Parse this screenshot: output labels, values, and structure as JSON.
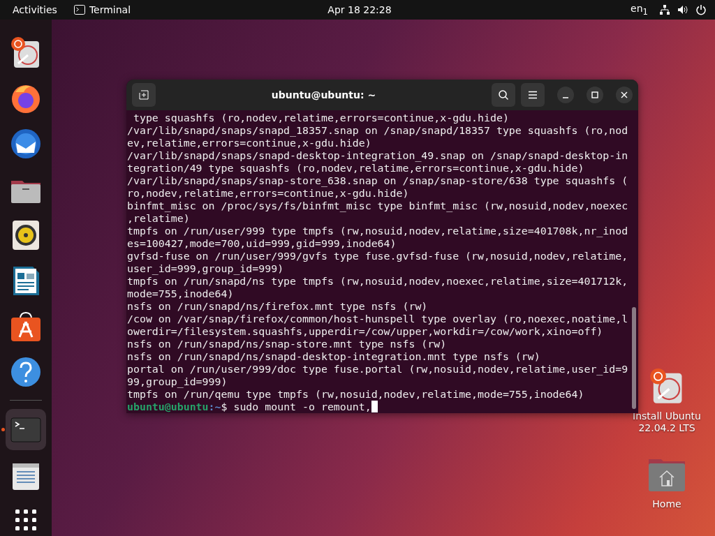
{
  "top_bar": {
    "activities": "Activities",
    "app_name": "Terminal",
    "clock": "Apr 18  22:28",
    "keyboard_layout": "en$_{1}$"
  },
  "dock": {
    "items": [
      {
        "kind": "installer",
        "running": false
      },
      {
        "kind": "browser",
        "running": false
      },
      {
        "kind": "mail",
        "running": false
      },
      {
        "kind": "files",
        "running": false
      },
      {
        "kind": "music",
        "running": false
      },
      {
        "kind": "writer",
        "running": false
      },
      {
        "kind": "store",
        "running": false
      },
      {
        "kind": "help",
        "running": false
      },
      {
        "kind": "terminal",
        "running": true
      },
      {
        "kind": "editor",
        "running": false
      }
    ]
  },
  "terminal": {
    "title": "ubuntu@ubuntu: ~",
    "lines": [
      " type squashfs (ro,nodev,relatime,errors=continue,x-gdu.hide)",
      "/var/lib/snapd/snaps/snapd_18357.snap on /snap/snapd/18357 type squashfs (ro,nod",
      "ev,relatime,errors=continue,x-gdu.hide)",
      "/var/lib/snapd/snaps/snapd-desktop-integration_49.snap on /snap/snapd-desktop-in",
      "tegration/49 type squashfs (ro,nodev,relatime,errors=continue,x-gdu.hide)",
      "/var/lib/snapd/snaps/snap-store_638.snap on /snap/snap-store/638 type squashfs (",
      "ro,nodev,relatime,errors=continue,x-gdu.hide)",
      "binfmt_misc on /proc/sys/fs/binfmt_misc type binfmt_misc (rw,nosuid,nodev,noexec",
      ",relatime)",
      "tmpfs on /run/user/999 type tmpfs (rw,nosuid,nodev,relatime,size=401708k,nr_inod",
      "es=100427,mode=700,uid=999,gid=999,inode64)",
      "gvfsd-fuse on /run/user/999/gvfs type fuse.gvfsd-fuse (rw,nosuid,nodev,relatime,",
      "user_id=999,group_id=999)",
      "tmpfs on /run/snapd/ns type tmpfs (rw,nosuid,nodev,noexec,relatime,size=401712k,",
      "mode=755,inode64)",
      "nsfs on /run/snapd/ns/firefox.mnt type nsfs (rw)",
      "/cow on /var/snap/firefox/common/host-hunspell type overlay (ro,noexec,noatime,l",
      "owerdir=/filesystem.squashfs,upperdir=/cow/upper,workdir=/cow/work,xino=off)",
      "nsfs on /run/snapd/ns/snap-store.mnt type nsfs (rw)",
      "nsfs on /run/snapd/ns/snapd-desktop-integration.mnt type nsfs (rw)",
      "portal on /run/user/999/doc type fuse.portal (rw,nosuid,nodev,relatime,user_id=9",
      "99,group_id=999)",
      "tmpfs on /run/qemu type tmpfs (rw,nosuid,nodev,relatime,mode=755,inode64)"
    ],
    "prompt": {
      "user_host": "ubuntu@ubuntu",
      "path": ":~",
      "symbol": "$",
      "command": "sudo mount -o remount,"
    }
  },
  "desktop_icons": [
    {
      "kind": "installer",
      "label": "Install Ubuntu 22.04.2 LTS"
    },
    {
      "kind": "home",
      "label": "Home"
    }
  ]
}
